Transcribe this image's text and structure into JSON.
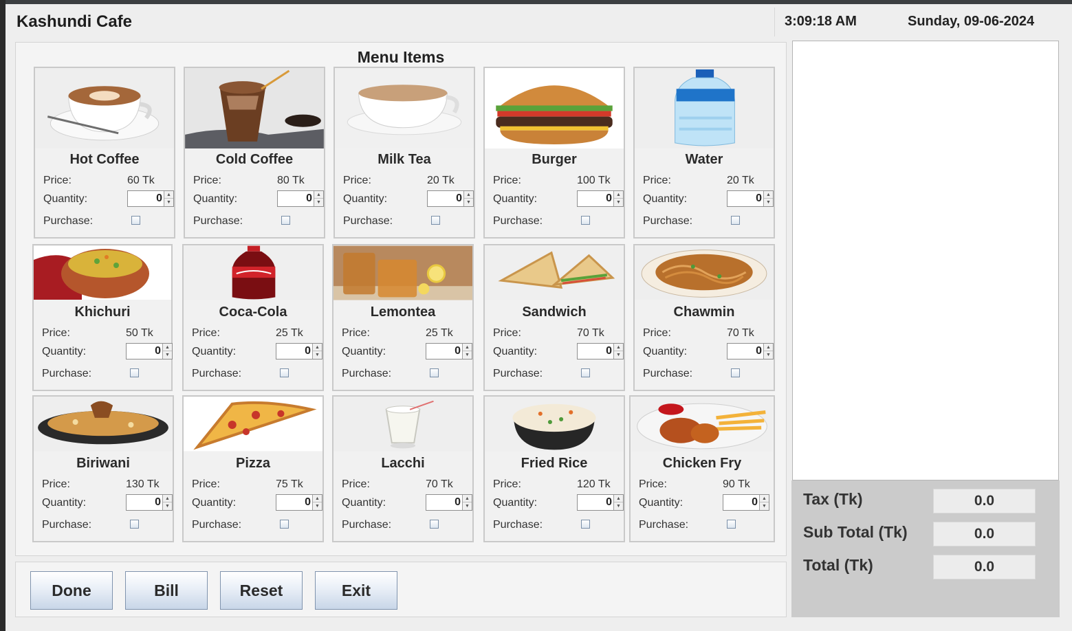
{
  "app": {
    "title": "Kashundi Cafe",
    "time": "3:09:18 AM",
    "date": "Sunday, 09-06-2024"
  },
  "menu": {
    "heading": "Menu Items",
    "price_label": "Price:",
    "quantity_label": "Quantity:",
    "purchase_label": "Purchase:",
    "items": [
      {
        "name": "Hot Coffee",
        "price": "60 Tk",
        "quantity": "0",
        "purchase": false,
        "image": "hot-coffee-image"
      },
      {
        "name": "Cold Coffee",
        "price": "80 Tk",
        "quantity": "0",
        "purchase": false,
        "image": "cold-coffee-image"
      },
      {
        "name": "Milk Tea",
        "price": "20 Tk",
        "quantity": "0",
        "purchase": false,
        "image": "milk-tea-image"
      },
      {
        "name": "Burger",
        "price": "100 Tk",
        "quantity": "0",
        "purchase": false,
        "image": "burger-image"
      },
      {
        "name": "Water",
        "price": "20 Tk",
        "quantity": "0",
        "purchase": false,
        "image": "water-bottle-image"
      },
      {
        "name": "Khichuri",
        "price": "50 Tk",
        "quantity": "0",
        "purchase": false,
        "image": "khichuri-image"
      },
      {
        "name": "Coca-Cola",
        "price": "25 Tk",
        "quantity": "0",
        "purchase": false,
        "image": "coca-cola-image"
      },
      {
        "name": "Lemontea",
        "price": "25 Tk",
        "quantity": "0",
        "purchase": false,
        "image": "lemontea-image"
      },
      {
        "name": "Sandwich",
        "price": "70 Tk",
        "quantity": "0",
        "purchase": false,
        "image": "sandwich-image"
      },
      {
        "name": "Chawmin",
        "price": "70 Tk",
        "quantity": "0",
        "purchase": false,
        "image": "chawmin-image"
      },
      {
        "name": "Biriwani",
        "price": "130 Tk",
        "quantity": "0",
        "purchase": false,
        "image": "biriwani-image"
      },
      {
        "name": "Pizza",
        "price": "75 Tk",
        "quantity": "0",
        "purchase": false,
        "image": "pizza-image"
      },
      {
        "name": "Lacchi",
        "price": "70 Tk",
        "quantity": "0",
        "purchase": false,
        "image": "lacchi-image"
      },
      {
        "name": "Fried Rice",
        "price": "120 Tk",
        "quantity": "0",
        "purchase": false,
        "image": "fried-rice-image"
      },
      {
        "name": "Chicken Fry",
        "price": "90 Tk",
        "quantity": "0",
        "purchase": false,
        "image": "chicken-fry-image"
      }
    ]
  },
  "buttons": {
    "done": "Done",
    "bill": "Bill",
    "reset": "Reset",
    "exit": "Exit"
  },
  "totals": {
    "tax_label": "Tax (Tk)",
    "tax_value": "0.0",
    "subtotal_label": "Sub Total (Tk)",
    "subtotal_value": "0.0",
    "total_label": "Total (Tk)",
    "total_value": "0.0"
  },
  "bill_text": ""
}
